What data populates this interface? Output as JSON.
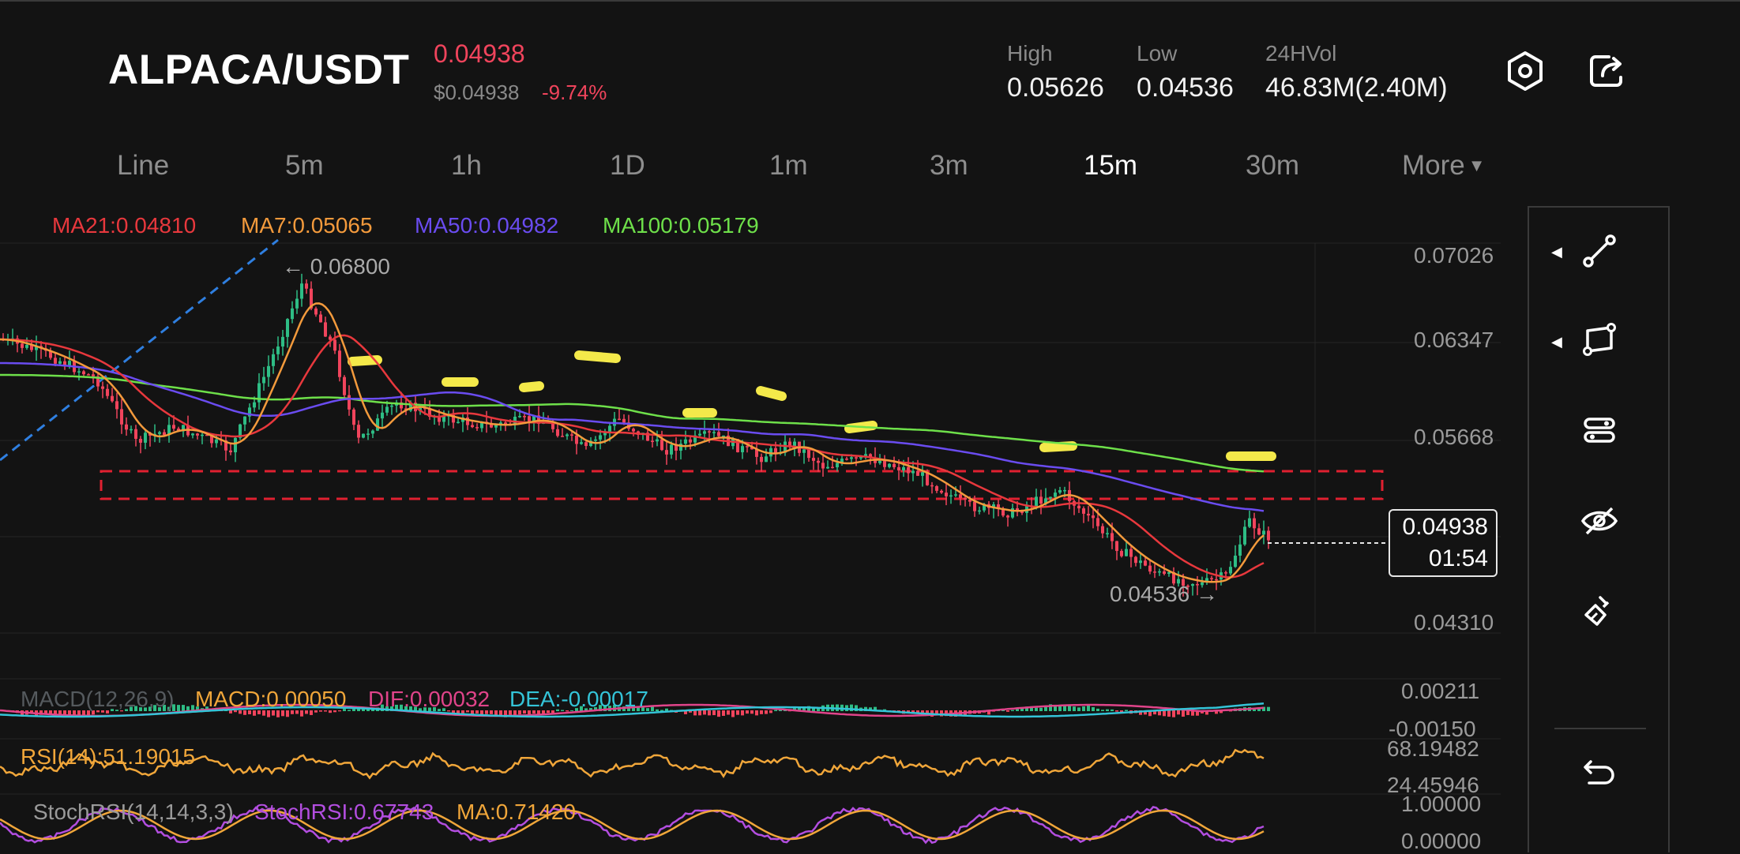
{
  "header": {
    "pair": "ALPACA/USDT",
    "last_price": "0.04938",
    "usd_price": "$0.04938",
    "change": "-9.74%",
    "high_label": "High",
    "high_value": "0.05626",
    "low_label": "Low",
    "low_value": "0.04536",
    "vol_label": "24HVol",
    "vol_value": "46.83M(2.40M)",
    "icons": [
      "settings-hex-icon",
      "share-icon"
    ]
  },
  "timeframes": [
    {
      "label": "Line",
      "active": false
    },
    {
      "label": "5m",
      "active": false
    },
    {
      "label": "1h",
      "active": false
    },
    {
      "label": "1D",
      "active": false
    },
    {
      "label": "1m",
      "active": false
    },
    {
      "label": "3m",
      "active": false
    },
    {
      "label": "15m",
      "active": true
    },
    {
      "label": "30m",
      "active": false
    },
    {
      "label": "More",
      "active": false
    }
  ],
  "ma_legend": [
    {
      "text": "MA21:0.04810",
      "color": "#e8383d"
    },
    {
      "text": "MA7:0.05065",
      "color": "#f39a3c"
    },
    {
      "text": "MA50:0.04982",
      "color": "#6a4cf0"
    },
    {
      "text": "MA100:0.05179",
      "color": "#6ee04a"
    }
  ],
  "price_axis": [
    "0.07026",
    "0.06347",
    "0.05668",
    "0.04310"
  ],
  "annotations": {
    "high_marker": "← 0.06800",
    "low_marker": "0.04536 →"
  },
  "current_price_box": {
    "price": "0.04938",
    "countdown": "01:54"
  },
  "macd": {
    "label": "MACD(12,26,9)",
    "macd": "MACD:0.00050",
    "dif": "DIF:0.00032",
    "dea": "DEA:-0.00017",
    "axis_top": "0.00211",
    "axis_bottom": "-0.00150"
  },
  "rsi": {
    "label": "RSI(14):51.19015",
    "axis_top": "68.19482",
    "axis_bottom": "24.45946"
  },
  "stoch": {
    "label": "StochRSI(14,14,3,3)",
    "value": "StochRSI:0.67743",
    "ma": "MA:0.71420",
    "axis_top": "1.00000",
    "axis_bottom": "0.00000"
  },
  "tools": [
    "trend-line-icon",
    "rectangle-icon",
    "indicator-settings-icon",
    "hide-drawings-icon",
    "clear-drawings-icon",
    "undo-icon"
  ],
  "colors": {
    "up": "#2ebd85",
    "down": "#f0445c",
    "ma21": "#e8383d",
    "ma7": "#f39a3c",
    "ma50": "#6a4cf0",
    "ma100": "#6ee04a",
    "zone": "#e02030",
    "dashes": "#f4e94a"
  },
  "chart_data": {
    "type": "candlestick",
    "price_high": "0.06800",
    "price_low": "0.04536",
    "last": "0.04938"
  }
}
